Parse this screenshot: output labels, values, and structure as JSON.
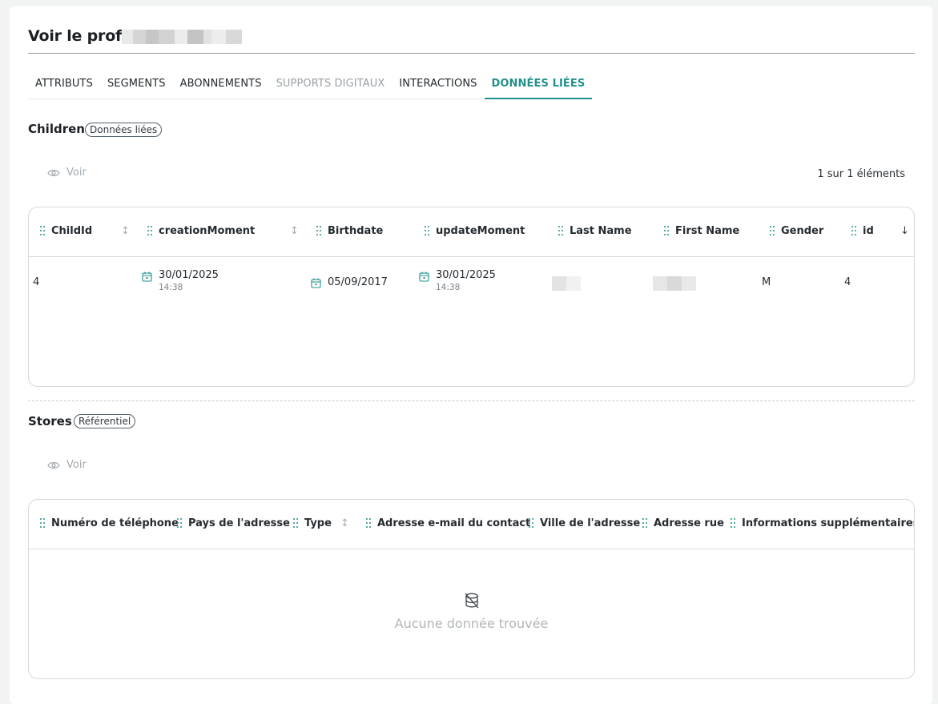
{
  "page": {
    "title": "Voir le profil"
  },
  "tabs": [
    {
      "label": "ATTRIBUTS",
      "state": "normal"
    },
    {
      "label": "SEGMENTS",
      "state": "normal"
    },
    {
      "label": "ABONNEMENTS",
      "state": "normal"
    },
    {
      "label": "SUPPORTS DIGITAUX",
      "state": "disabled"
    },
    {
      "label": "INTERACTIONS",
      "state": "normal"
    },
    {
      "label": "DONNÉES LIÉES",
      "state": "active"
    }
  ],
  "colors": {
    "accent": "#21918a",
    "muted": "#a3aab0",
    "text": "#252b30"
  },
  "children": {
    "title": "Children",
    "badge": "Données liées",
    "voir_label": "Voir",
    "count_label": "1 sur 1 éléments",
    "columns": [
      "ChildId",
      "creationMoment",
      "Birthdate",
      "updateMoment",
      "Last Name",
      "First Name",
      "Gender",
      "id"
    ],
    "row": {
      "child_id": "4",
      "creation_date": "30/01/2025",
      "creation_time": "14:38",
      "birthdate": "05/09/2017",
      "update_date": "30/01/2025",
      "update_time": "14:38",
      "gender": "M",
      "id": "4"
    }
  },
  "stores": {
    "title": "Stores",
    "badge": "Référentiel",
    "voir_label": "Voir",
    "columns": [
      "Numéro de téléphone",
      "Pays de l'adresse",
      "Type",
      "Adresse e-mail du contact",
      "Ville de l'adresse",
      "Adresse rue",
      "Informations supplémentaires sur"
    ],
    "empty_text": "Aucune donnée trouvée"
  },
  "icons": {
    "drag": "drag-handle-icon",
    "sort": "sort-icon",
    "sort_desc": "sort-desc-icon",
    "calendar": "calendar-icon",
    "eye": "eye-icon",
    "no_data": "database-off-icon"
  }
}
